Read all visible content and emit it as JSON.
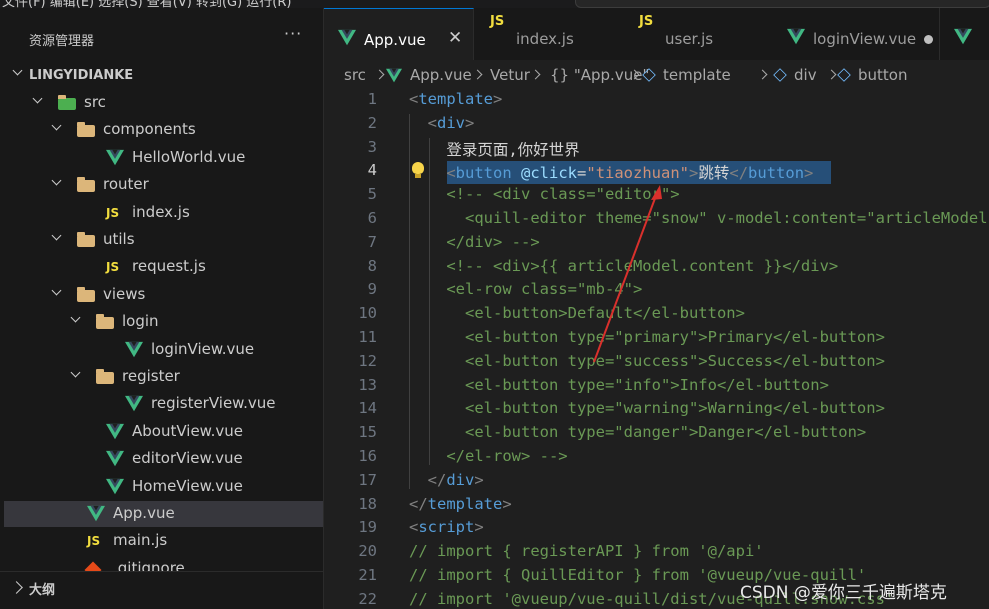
{
  "menubar": {
    "text": "文件(F)  编辑(E)  选择(S)  查看(V)  转到(G)  运行(R)"
  },
  "explorer": {
    "title": "资源管理器",
    "more_label": "···",
    "project": "LINGYIDIANKE",
    "tree": [
      {
        "label": "src",
        "type": "folder-src",
        "depth": 1,
        "expanded": true
      },
      {
        "label": "components",
        "type": "folder",
        "depth": 2,
        "expanded": true
      },
      {
        "label": "HelloWorld.vue",
        "type": "vue",
        "depth": 3
      },
      {
        "label": "router",
        "type": "folder",
        "depth": 2,
        "expanded": true
      },
      {
        "label": "index.js",
        "type": "js",
        "depth": 3
      },
      {
        "label": "utils",
        "type": "folder",
        "depth": 2,
        "expanded": true
      },
      {
        "label": "request.js",
        "type": "js",
        "depth": 3
      },
      {
        "label": "views",
        "type": "folder",
        "depth": 2,
        "expanded": true
      },
      {
        "label": "login",
        "type": "folder",
        "depth": 3,
        "expanded": true
      },
      {
        "label": "loginView.vue",
        "type": "vue",
        "depth": 4
      },
      {
        "label": "register",
        "type": "folder",
        "depth": 3,
        "expanded": true
      },
      {
        "label": "registerView.vue",
        "type": "vue",
        "depth": 4
      },
      {
        "label": "AboutView.vue",
        "type": "vue",
        "depth": 3
      },
      {
        "label": "editorView.vue",
        "type": "vue",
        "depth": 3
      },
      {
        "label": "HomeView.vue",
        "type": "vue",
        "depth": 3
      },
      {
        "label": "App.vue",
        "type": "vue",
        "depth": 2,
        "selected": true
      },
      {
        "label": "main.js",
        "type": "js",
        "depth": 2
      },
      {
        "label": ".gitignore",
        "type": "git",
        "depth": 2
      }
    ],
    "outline_title": "大纲"
  },
  "tabs": [
    {
      "label": "App.vue",
      "icon": "vue-icon",
      "active": true,
      "close": "✕"
    },
    {
      "label": "index.js",
      "icon": "js-icon"
    },
    {
      "label": "user.js",
      "icon": "js-icon"
    },
    {
      "label": "loginView.vue",
      "icon": "vue-icon",
      "modified": true
    }
  ],
  "breadcrumb": {
    "items": [
      "src",
      "App.vue",
      "Vetur",
      "{} \"App.vue\"",
      "template",
      "div",
      "button"
    ]
  },
  "editor": {
    "current_line": 4,
    "lines": [
      [
        [
          "tk-br",
          "<"
        ],
        [
          "tk-tag",
          "template"
        ],
        [
          "tk-br",
          ">"
        ]
      ],
      [
        [
          "tk-txt",
          "  "
        ],
        [
          "tk-br",
          "<"
        ],
        [
          "tk-tag",
          "div"
        ],
        [
          "tk-br",
          ">"
        ]
      ],
      [
        [
          "tk-txt",
          "    登录页面,你好世界"
        ]
      ],
      [
        [
          "tk-txt",
          "    "
        ],
        [
          "tk-br",
          "<"
        ],
        [
          "tk-tag",
          "button"
        ],
        [
          "tk-txt",
          " "
        ],
        [
          "tk-attr",
          "@click"
        ],
        [
          "tk-txt",
          "="
        ],
        [
          "tk-str",
          "\"tiaozhuan\""
        ],
        [
          "tk-br",
          ">"
        ],
        [
          "tk-txt",
          "跳转"
        ],
        [
          "tk-br",
          "</"
        ],
        [
          "tk-tag",
          "button"
        ],
        [
          "tk-br",
          ">"
        ]
      ],
      [
        [
          "tk-com",
          "    <!-- <div class=\"editor\">"
        ]
      ],
      [
        [
          "tk-com",
          "      <quill-editor theme=\"snow\" v-model:content=\"articleModel"
        ]
      ],
      [
        [
          "tk-com",
          "    </div> -->"
        ]
      ],
      [
        [
          "tk-com",
          "    <!-- <div>{{ articleModel.content }}</div>"
        ]
      ],
      [
        [
          "tk-com",
          "    <el-row class=\"mb-4\">"
        ]
      ],
      [
        [
          "tk-com",
          "      <el-button>Default</el-button>"
        ]
      ],
      [
        [
          "tk-com",
          "      <el-button type=\"primary\">Primary</el-button>"
        ]
      ],
      [
        [
          "tk-com",
          "      <el-button type=\"success\">Success</el-button>"
        ]
      ],
      [
        [
          "tk-com",
          "      <el-button type=\"info\">Info</el-button>"
        ]
      ],
      [
        [
          "tk-com",
          "      <el-button type=\"warning\">Warning</el-button>"
        ]
      ],
      [
        [
          "tk-com",
          "      <el-button type=\"danger\">Danger</el-button>"
        ]
      ],
      [
        [
          "tk-com",
          "    </el-row> -->"
        ]
      ],
      [
        [
          "tk-txt",
          "  "
        ],
        [
          "tk-br",
          "</"
        ],
        [
          "tk-tag",
          "div"
        ],
        [
          "tk-br",
          ">"
        ]
      ],
      [
        [
          "tk-br",
          "</"
        ],
        [
          "tk-tag",
          "template"
        ],
        [
          "tk-br",
          ">"
        ]
      ],
      [
        [
          "tk-br",
          "<"
        ],
        [
          "tk-tag",
          "script"
        ],
        [
          "tk-br",
          ">"
        ]
      ],
      [
        [
          "tk-com",
          "// import { registerAPI } from '@/api'"
        ]
      ],
      [
        [
          "tk-com",
          "// import { QuillEditor } from '@vueup/vue-quill'"
        ]
      ],
      [
        [
          "tk-com",
          "// import '@vueup/vue-quill/dist/vue-quill.snow.css'"
        ]
      ]
    ]
  },
  "watermark": "CSDN @爱你三千遍斯塔克",
  "colors": {
    "accent": "#0078d4",
    "selection": "#264f78",
    "annotation_arrow": "#d9302c"
  }
}
